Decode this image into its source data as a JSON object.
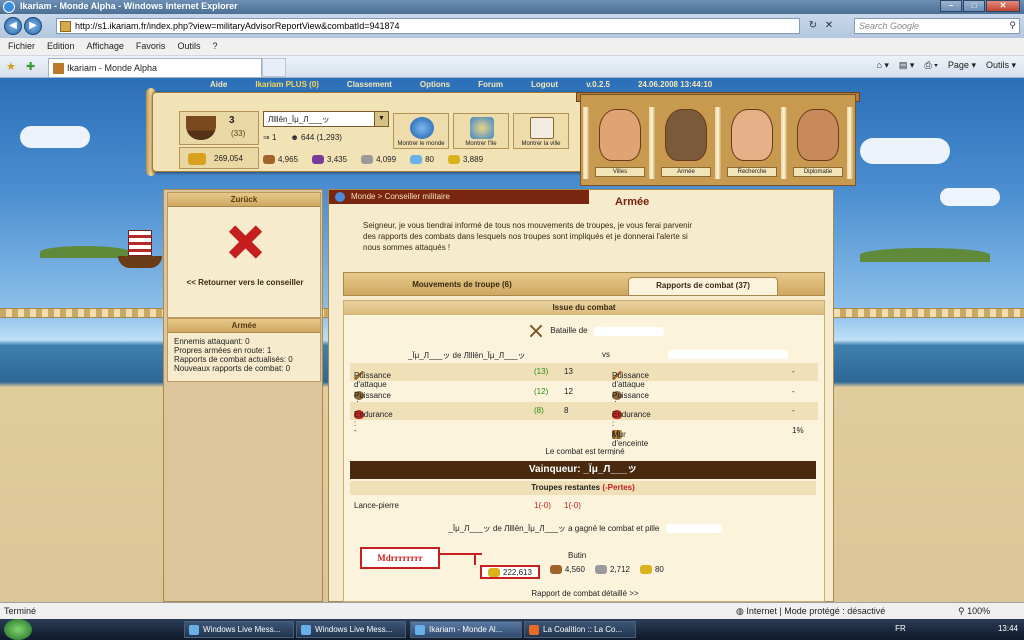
{
  "browser": {
    "title": "Ikariam - Monde Alpha - Windows Internet Explorer",
    "url": "http://s1.ikariam.fr/index.php?view=militaryAdvisorReportView&combatId=941874",
    "search_placeholder": "Search Google",
    "menu": [
      "Fichier",
      "Edition",
      "Affichage",
      "Favoris",
      "Outils",
      "?"
    ],
    "tab_title": "Ikariam - Monde Alpha",
    "commands": [
      "Page ▾",
      "Outils ▾"
    ]
  },
  "game_nav": {
    "items": [
      "Aide",
      "Ikariam PLUS (0)",
      "Classement",
      "Options",
      "Forum",
      "Logout",
      "v.0.2.5",
      "24.06.2008 13:44:10"
    ]
  },
  "city_panel": {
    "town_count": "3",
    "town_sub": "(33)",
    "gold": "269,054",
    "city_name": "Лlllēn_Ϊμ_Л___ッ",
    "action_points": "1",
    "population": "644 (1,293)",
    "buttons": [
      "Montrer le monde",
      "Montrer l'île",
      "Montrer la ville"
    ],
    "resources": [
      {
        "name": "wood",
        "value": "4,965",
        "color": "#a0642a"
      },
      {
        "name": "wine",
        "value": "3,435",
        "color": "#7a3a9a"
      },
      {
        "name": "marble",
        "value": "4,099",
        "color": "#9a9a9a"
      },
      {
        "name": "crystal",
        "value": "80",
        "color": "#6ab0e8"
      },
      {
        "name": "sulfur",
        "value": "3,889",
        "color": "#d9b21d"
      }
    ]
  },
  "advisors": [
    "Villes",
    "Armée",
    "Recherche",
    "Diplomatie"
  ],
  "sidebar": {
    "back_box_title": "Zurück",
    "back_link": "<< Retourner vers le conseiller",
    "army_box_title": "Armée",
    "army_stats": [
      "Ennemis attaquant: 0",
      "Propres armées en route: 1",
      "Rapports de combat actualisés: 0",
      "Nouveaux rapports de combat: 0"
    ]
  },
  "main": {
    "breadcrumb": "Monde > Conseiller militaire",
    "title": "Armée",
    "intro": "Seigneur, je vous tiendrai informé de tous nos mouvements de troupes, je vous ferai parvenir des rapports des combats dans lesquels nos troupes sont impliqués et je donnerai l'alerte si nous sommes attaqués !",
    "tabs": [
      "Mouvements de troupe (6)",
      "Rapports de combat (37)"
    ]
  },
  "report": {
    "header": "Issue du combat",
    "battle_of": "Bataille de",
    "attacker": "_Ϊμ_Л___ッ de Лlllēn_Ϊμ_Л___ッ",
    "vs": "vs",
    "stats": [
      {
        "label": "Puissance d'attaque :",
        "bonus": "(13)",
        "value": "13",
        "def_label": "Puissance d'attaque :",
        "def_value": "-"
      },
      {
        "label": "Puissance de défense :",
        "bonus": "(12)",
        "value": "12",
        "def_label": "Puissance de défense :",
        "def_value": "-"
      },
      {
        "label": "Endurance :",
        "bonus": "(8)",
        "value": "8",
        "def_label": "Endurance :",
        "def_value": "-"
      },
      {
        "label": "-",
        "bonus": "",
        "value": "",
        "def_label": "Mur d'enceinte :",
        "def_value": "1%"
      }
    ],
    "combat_end": "Le combat est terminé",
    "winner": "Vainqueur: _Ϊμ_Л___ッ",
    "troops_header": "Troupes restantes",
    "losses_label": "(-Pertes)",
    "troops": [
      {
        "unit": "Lance-pierre",
        "attacker": "1(-0)",
        "defender": "1(-0)"
      }
    ],
    "win_line": "_Ϊμ_Л___ッ de Лlllēn_Ϊμ_Л___ッ a gagné le combat et pille",
    "annotation": "Mdrrrrrrrr",
    "booty_label": "Butin",
    "booty": [
      {
        "name": "gold",
        "value": "222,613",
        "color": "#d9b21d"
      },
      {
        "name": "wood",
        "value": "4,560",
        "color": "#a0642a"
      },
      {
        "name": "marble",
        "value": "2,712",
        "color": "#9a9a9a"
      },
      {
        "name": "sulfur",
        "value": "80",
        "color": "#d9b21d"
      }
    ],
    "detail_link": "Rapport de combat détaillé >>"
  },
  "statusbar": {
    "left": "Terminé",
    "zone": "Internet | Mode protégé : désactivé",
    "zoom": "100%"
  },
  "taskbar": {
    "buttons": [
      "Windows Live Mess...",
      "Windows Live Mess...",
      "Ikariam - Monde Al...",
      "La Coalition :: La Co..."
    ],
    "lang": "FR",
    "clock": "13:44"
  }
}
